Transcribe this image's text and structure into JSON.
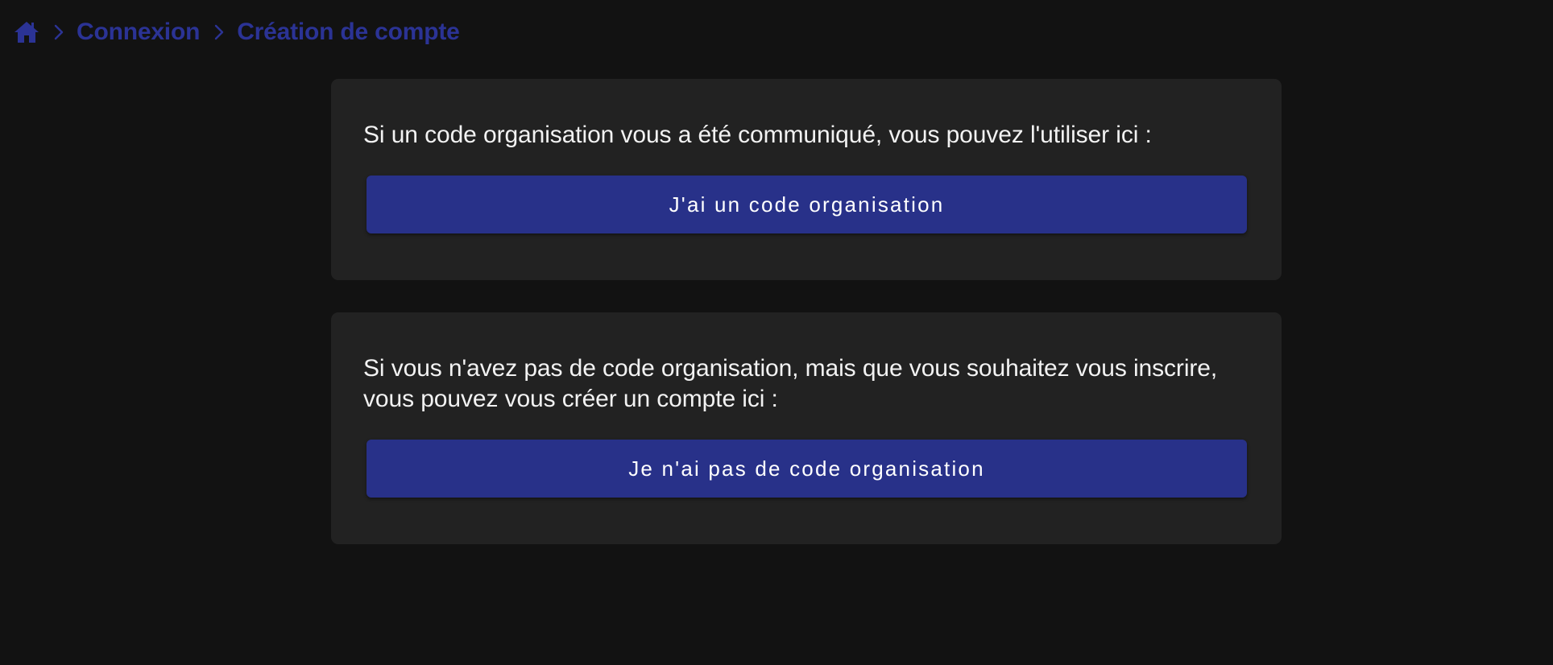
{
  "breadcrumb": {
    "home_icon": "home-icon",
    "separator_icon": "chevron-right-icon",
    "items": [
      {
        "label": "Connexion"
      },
      {
        "label": "Création de compte"
      }
    ]
  },
  "cards": [
    {
      "text": "Si un code organisation vous a été communiqué, vous pouvez l'utiliser ici :",
      "button_label": "J'ai un code organisation"
    },
    {
      "text": "Si vous n'avez pas de code organisation, mais que vous souhaitez vous inscrire, vous pouvez vous créer un compte ici :",
      "button_label": "Je n'ai pas de code organisation"
    }
  ],
  "colors": {
    "background": "#121212",
    "card": "#222222",
    "accent": "#283189",
    "breadcrumb": "#2b3395",
    "text": "#f2f2f2"
  }
}
